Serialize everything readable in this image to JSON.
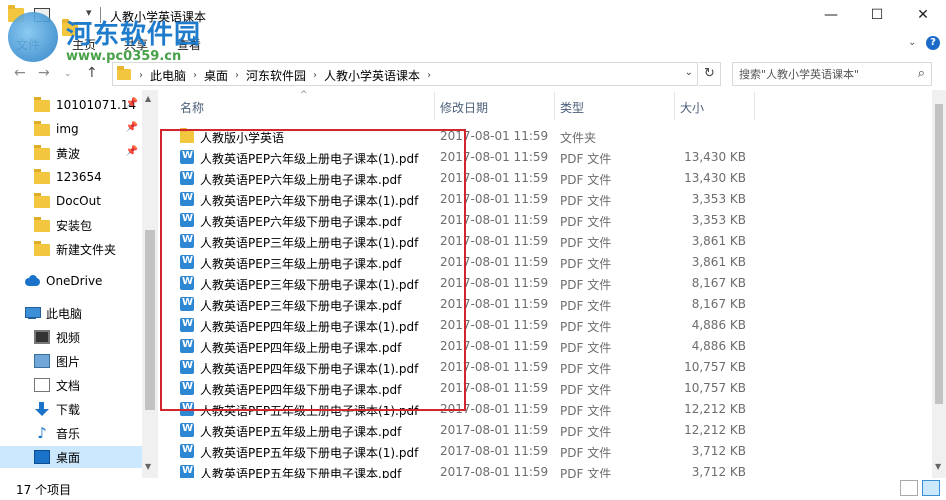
{
  "window": {
    "title": "人教小学英语课本",
    "minimize": "—",
    "maximize": "☐",
    "close": "✕"
  },
  "watermark": {
    "name": "河东软件园",
    "url": "www.pc0359.cn"
  },
  "ribbon": {
    "tabs": [
      "文件",
      "主页",
      "共享",
      "查看"
    ],
    "help": "?"
  },
  "address": {
    "crumbs": [
      "此电脑",
      "桌面",
      "河东软件园",
      "人教小学英语课本"
    ],
    "search_placeholder": "搜索\"人教小学英语课本\""
  },
  "nav": {
    "quick_access": [
      {
        "label": "10101071.14",
        "pinned": true
      },
      {
        "label": "img",
        "pinned": true
      },
      {
        "label": "黄波",
        "pinned": true
      },
      {
        "label": "123654",
        "pinned": false
      },
      {
        "label": "DocOut",
        "pinned": false
      },
      {
        "label": "安装包",
        "pinned": false
      },
      {
        "label": "新建文件夹",
        "pinned": false
      }
    ],
    "onedrive": "OneDrive",
    "this_pc": "此电脑",
    "pc_items": [
      "视频",
      "图片",
      "文档",
      "下载",
      "音乐",
      "桌面"
    ],
    "selected": "桌面"
  },
  "columns": {
    "name": "名称",
    "date": "修改日期",
    "type": "类型",
    "size": "大小"
  },
  "files": [
    {
      "name": "人教版小学英语",
      "date": "2017-08-01 11:59",
      "type": "文件夹",
      "size": "",
      "kind": "folder"
    },
    {
      "name": "人教英语PEP六年级上册电子课本(1).pdf",
      "date": "2017-08-01 11:59",
      "type": "PDF 文件",
      "size": "13,430 KB",
      "kind": "pdf"
    },
    {
      "name": "人教英语PEP六年级上册电子课本.pdf",
      "date": "2017-08-01 11:59",
      "type": "PDF 文件",
      "size": "13,430 KB",
      "kind": "pdf"
    },
    {
      "name": "人教英语PEP六年级下册电子课本(1).pdf",
      "date": "2017-08-01 11:59",
      "type": "PDF 文件",
      "size": "3,353 KB",
      "kind": "pdf"
    },
    {
      "name": "人教英语PEP六年级下册电子课本.pdf",
      "date": "2017-08-01 11:59",
      "type": "PDF 文件",
      "size": "3,353 KB",
      "kind": "pdf"
    },
    {
      "name": "人教英语PEP三年级上册电子课本(1).pdf",
      "date": "2017-08-01 11:59",
      "type": "PDF 文件",
      "size": "3,861 KB",
      "kind": "pdf"
    },
    {
      "name": "人教英语PEP三年级上册电子课本.pdf",
      "date": "2017-08-01 11:59",
      "type": "PDF 文件",
      "size": "3,861 KB",
      "kind": "pdf"
    },
    {
      "name": "人教英语PEP三年级下册电子课本(1).pdf",
      "date": "2017-08-01 11:59",
      "type": "PDF 文件",
      "size": "8,167 KB",
      "kind": "pdf"
    },
    {
      "name": "人教英语PEP三年级下册电子课本.pdf",
      "date": "2017-08-01 11:59",
      "type": "PDF 文件",
      "size": "8,167 KB",
      "kind": "pdf"
    },
    {
      "name": "人教英语PEP四年级上册电子课本(1).pdf",
      "date": "2017-08-01 11:59",
      "type": "PDF 文件",
      "size": "4,886 KB",
      "kind": "pdf"
    },
    {
      "name": "人教英语PEP四年级上册电子课本.pdf",
      "date": "2017-08-01 11:59",
      "type": "PDF 文件",
      "size": "4,886 KB",
      "kind": "pdf"
    },
    {
      "name": "人教英语PEP四年级下册电子课本(1).pdf",
      "date": "2017-08-01 11:59",
      "type": "PDF 文件",
      "size": "10,757 KB",
      "kind": "pdf"
    },
    {
      "name": "人教英语PEP四年级下册电子课本.pdf",
      "date": "2017-08-01 11:59",
      "type": "PDF 文件",
      "size": "10,757 KB",
      "kind": "pdf"
    },
    {
      "name": "人教英语PEP五年级上册电子课本(1).pdf",
      "date": "2017-08-01 11:59",
      "type": "PDF 文件",
      "size": "12,212 KB",
      "kind": "pdf"
    },
    {
      "name": "人教英语PEP五年级上册电子课本.pdf",
      "date": "2017-08-01 11:59",
      "type": "PDF 文件",
      "size": "12,212 KB",
      "kind": "pdf"
    },
    {
      "name": "人教英语PEP五年级下册电子课本(1).pdf",
      "date": "2017-08-01 11:59",
      "type": "PDF 文件",
      "size": "3,712 KB",
      "kind": "pdf"
    },
    {
      "name": "人教英语PEP五年级下册电子课本.pdf",
      "date": "2017-08-01 11:59",
      "type": "PDF 文件",
      "size": "3,712 KB",
      "kind": "pdf"
    }
  ],
  "status": {
    "item_count": "17 个项目"
  },
  "colors": {
    "highlight": "#d2262e",
    "selection": "#cce8ff",
    "accent": "#1a73c8"
  }
}
